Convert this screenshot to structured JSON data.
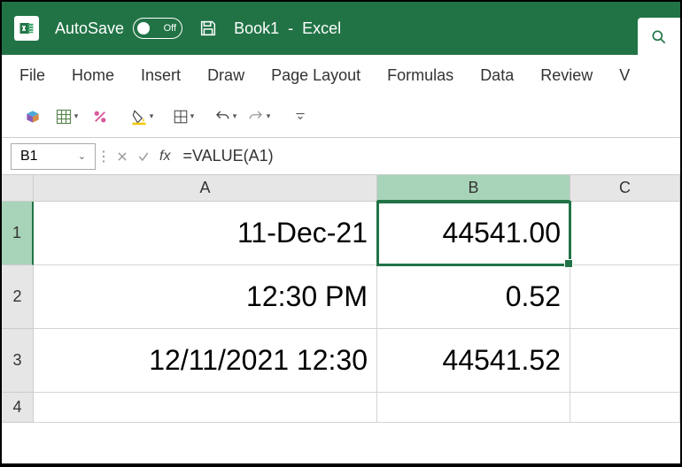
{
  "titlebar": {
    "autosave_label": "AutoSave",
    "autosave_state": "Off",
    "doc_name": "Book1",
    "app_name": "Excel"
  },
  "ribbon": {
    "tabs": [
      "File",
      "Home",
      "Insert",
      "Draw",
      "Page Layout",
      "Formulas",
      "Data",
      "Review",
      "V"
    ]
  },
  "formula_bar": {
    "name_box": "B1",
    "formula": "=VALUE(A1)"
  },
  "columns": [
    "A",
    "B",
    "C"
  ],
  "rows": [
    "1",
    "2",
    "3",
    "4"
  ],
  "cells": {
    "A1": "11-Dec-21",
    "B1": "44541.00",
    "A2": "12:30 PM",
    "B2": "0.52",
    "A3": "12/11/2021 12:30",
    "B3": "44541.52"
  },
  "selected_cell": "B1"
}
